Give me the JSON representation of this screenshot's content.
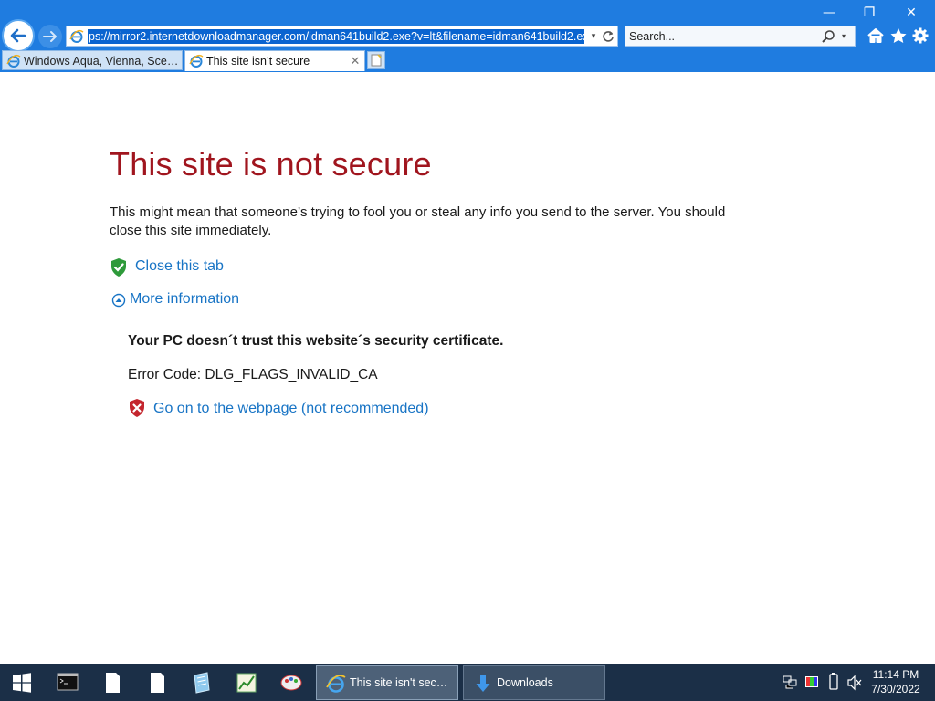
{
  "window": {
    "minimize_glyph": "—",
    "restore_glyph": "❐",
    "close_glyph": "✕"
  },
  "navigation": {
    "back_icon": "arrow-left-icon",
    "forward_icon": "arrow-right-icon"
  },
  "address_bar": {
    "url": "ps://mirror2.internetdownloadmanager.com/idman641build2.exe?v=lt&filename=idman641build2.exe",
    "dropdown_glyph": "▾"
  },
  "search": {
    "placeholder": "Search...",
    "dropdown_glyph": "▾"
  },
  "toolbar": {
    "icons": [
      "home-icon",
      "favorites-star-icon",
      "settings-gear-icon"
    ]
  },
  "tabs": [
    {
      "label": "Windows Aqua, Vienna, Scenic...",
      "active": false
    },
    {
      "label": "This site isn’t secure",
      "active": true,
      "close_glyph": "✕"
    }
  ],
  "page": {
    "title": "This site is not secure",
    "description": "This might mean that someone’s trying to fool you or steal any info you send to the server. You should close this site immediately.",
    "close_tab_link": "Close this tab",
    "more_info_link": "More information",
    "trust_message": "Your PC doesn´t trust this website´s security certificate.",
    "error_code": "Error Code: DLG_FLAGS_INVALID_CA",
    "go_on_link": "Go on to the webpage (not recommended)"
  },
  "colors": {
    "title_red": "#a0151e",
    "link_blue": "#1874c5",
    "chrome_blue": "#1f7ce0",
    "taskbar": "#1b2f47"
  },
  "taskbar": {
    "tasks": [
      {
        "label": "This site isn't secur...",
        "icon": "internet-explorer-icon"
      },
      {
        "label": "Downloads",
        "icon": "download-arrow-icon"
      }
    ],
    "clock_time": "11:14 PM",
    "clock_date": "7/30/2022"
  }
}
